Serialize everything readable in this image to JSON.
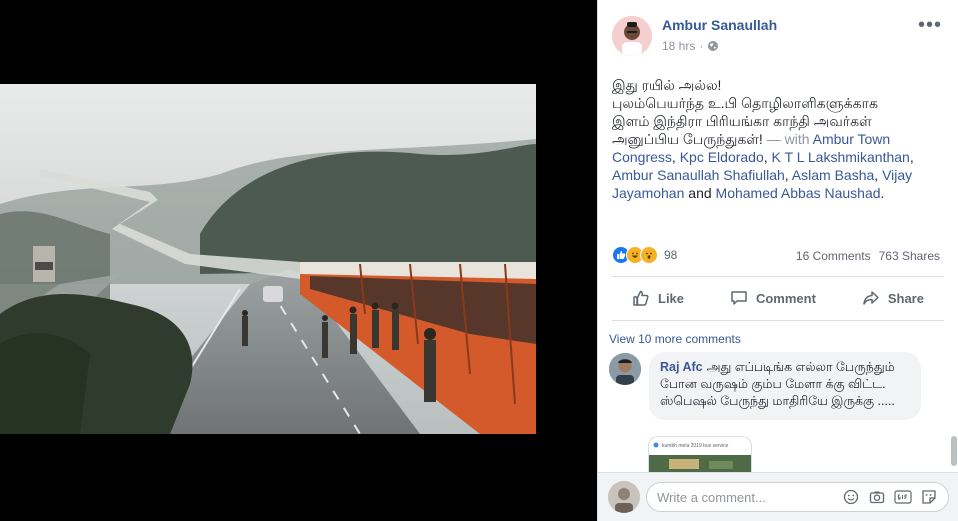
{
  "post": {
    "author": "Ambur Sanaullah",
    "time": "18 hrs",
    "privacy_icon": "globe-icon",
    "text_lines": [
      "இது ரயில் அல்ல!",
      "புலம்பெயர்ந்த உ.பி தொழிலாளிகளுக்காக",
      "இளம் இந்திரா பிரியங்கா காந்தி அவர்கள்",
      "அனுப்பிய பேருந்துகள்!"
    ],
    "with_prefix": " — with ",
    "tags": [
      "Ambur Town Congress",
      "Kpc Eldorado",
      "K T L Lakshmikanthan",
      "Ambur Sanaullah Shafiullah",
      "Aslam Basha",
      "Vijay Jayamohan",
      "Mohamed Abbas Naushad"
    ],
    "sep1": ", ",
    "sep_and": " and ",
    "end": "."
  },
  "stats": {
    "reaction_count": "98",
    "comments": "16 Comments",
    "shares": "763 Shares"
  },
  "actions": {
    "like": "Like",
    "comment": "Comment",
    "share": "Share"
  },
  "comments": {
    "view_more": "View 10 more comments",
    "items": [
      {
        "author": "Raj Afc",
        "text": "அது எப்படிங்க எல்லா பேருந்தும் போன வருஷம் கும்ப மேளா க்கு விட்ட. ஸ்பெஷல் பேருந்து மாதிரியே இருக்கு .....",
        "attachment_caption": "kumbh mela 2019 bus service"
      }
    ]
  },
  "composer": {
    "placeholder": "Write a comment..."
  },
  "colors": {
    "link": "#385898",
    "like_blue": "#1877f2",
    "reaction_yellow": "#f7b125"
  }
}
